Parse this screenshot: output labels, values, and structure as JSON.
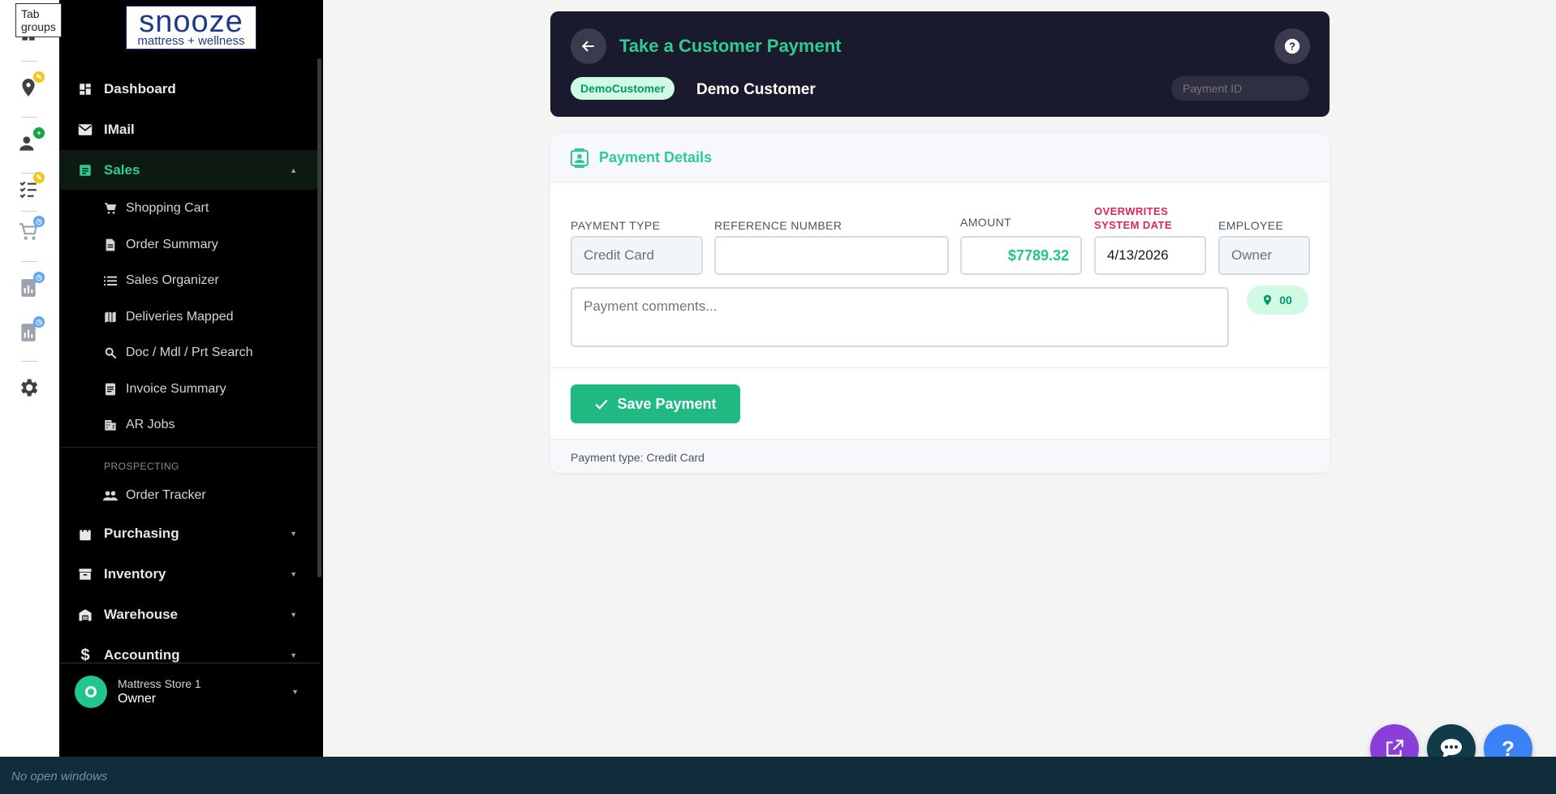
{
  "rail": {
    "tooltip": "Tab groups",
    "items": [
      {
        "icon": "home-icon"
      },
      {
        "icon": "location-pin-icon",
        "badge_color": "#f5c518"
      },
      {
        "icon": "person-add-icon",
        "badge_color": "#16a34a"
      },
      {
        "icon": "checklist-icon",
        "badge_color": "#f5c518"
      },
      {
        "icon": "cart-icon",
        "badge_color": "#60a5fa"
      },
      {
        "icon": "report-icon",
        "badge_color": "#60a5fa"
      },
      {
        "icon": "report-icon",
        "badge_color": "#60a5fa"
      },
      {
        "icon": "gear-icon"
      }
    ]
  },
  "logo": {
    "word": "snooze",
    "sub": "mattress + wellness"
  },
  "sidebar": {
    "items": [
      {
        "label": "Dashboard",
        "icon": "dashboard-icon"
      },
      {
        "label": "IMail",
        "icon": "mail-icon"
      },
      {
        "label": "Sales",
        "icon": "sales-icon",
        "expanded": true
      }
    ],
    "sales_sub": [
      {
        "label": "Shopping Cart",
        "icon": "cart-icon"
      },
      {
        "label": "Order Summary",
        "icon": "document-icon"
      },
      {
        "label": "Sales Organizer",
        "icon": "list-icon"
      },
      {
        "label": "Deliveries Mapped",
        "icon": "map-icon"
      },
      {
        "label": "Doc / Mdl / Prt Search",
        "icon": "search-icon"
      },
      {
        "label": "Invoice Summary",
        "icon": "invoice-icon"
      },
      {
        "label": "AR Jobs",
        "icon": "building-icon"
      }
    ],
    "section_label": "PROSPECTING",
    "prospect_sub": [
      {
        "label": "Order Tracker",
        "icon": "people-icon"
      }
    ],
    "bottom_items": [
      {
        "label": "Purchasing",
        "icon": "bag-icon"
      },
      {
        "label": "Inventory",
        "icon": "archive-icon"
      },
      {
        "label": "Warehouse",
        "icon": "warehouse-icon"
      },
      {
        "label": "Accounting",
        "icon": "dollar-icon"
      }
    ],
    "store": {
      "name": "Mattress Store 1",
      "role": "Owner"
    }
  },
  "header": {
    "title": "Take a Customer Payment",
    "customer_badge": "DemoCustomer",
    "customer_name": "Demo Customer",
    "payment_id_placeholder": "Payment ID"
  },
  "details": {
    "title": "Payment Details",
    "labels": {
      "payment_type": "PAYMENT TYPE",
      "reference_number": "REFERENCE NUMBER",
      "amount": "AMOUNT",
      "overwrites_1": "OVERWRITES",
      "overwrites_2": "SYSTEM DATE",
      "employee": "EMPLOYEE"
    },
    "values": {
      "payment_type": "Credit Card",
      "reference_number": "",
      "amount": "$7789.32",
      "date": "4/13/2026",
      "employee": "Owner"
    },
    "comments_placeholder": "Payment comments...",
    "location_code": "00",
    "save_label": "Save Payment",
    "footer_text": "Payment type: Credit Card"
  },
  "footer": {
    "text": "No open windows"
  },
  "colors": {
    "accent": "#2ecc8f",
    "header_bg": "#1a1a2e",
    "sidebar_bg": "#000000",
    "danger": "#dc2653"
  }
}
